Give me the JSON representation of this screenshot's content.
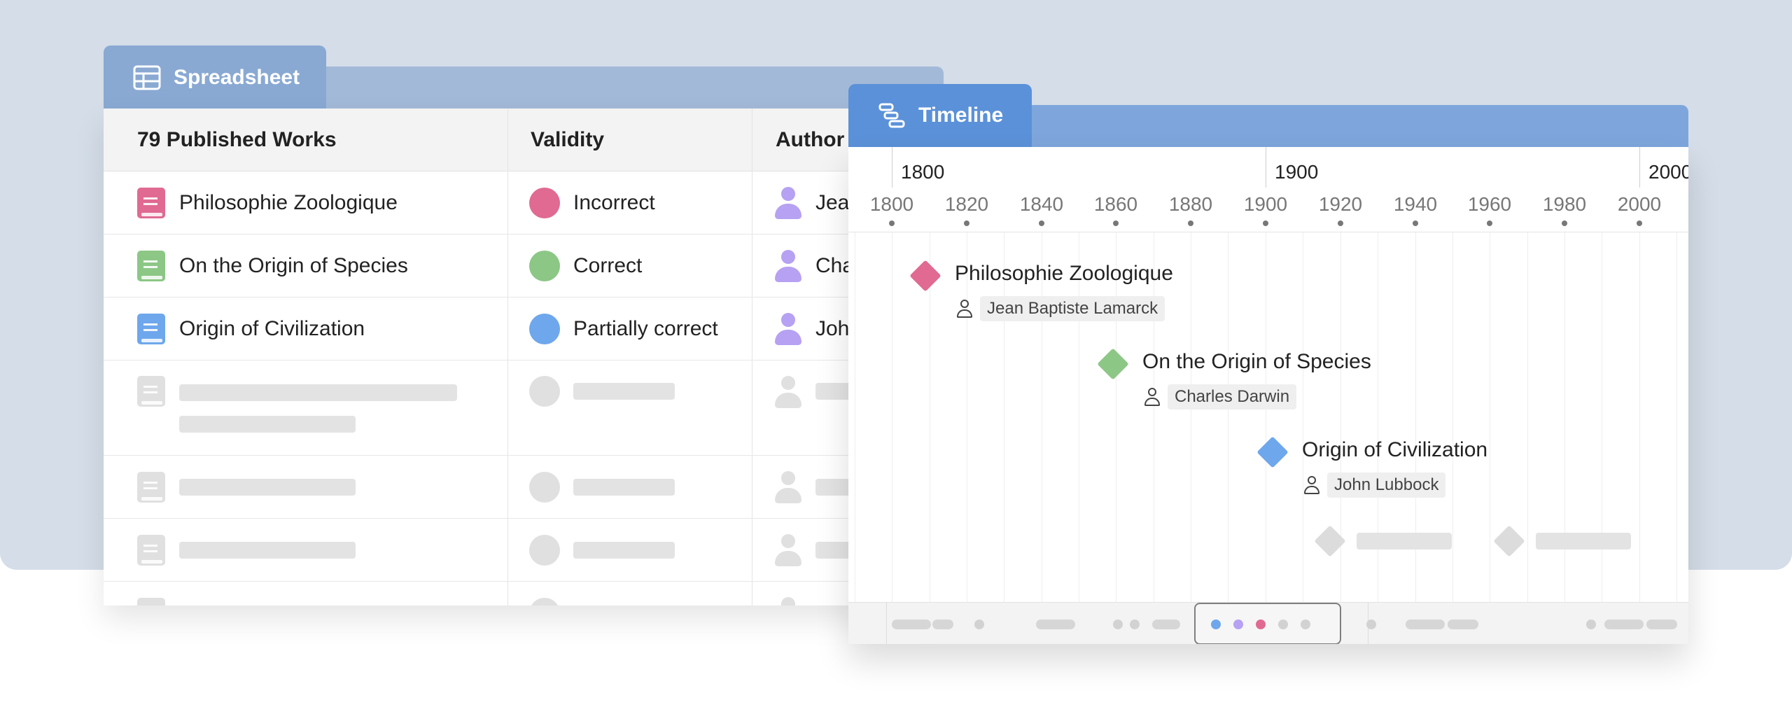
{
  "colors": {
    "background": "#d4dde8",
    "sheet_tab": "#89a9d3",
    "timeline_tab": "#5b91d8",
    "pink": "#e06a92",
    "green": "#8cc786",
    "blue": "#6ea7ec",
    "purple": "#b6a1f2",
    "placeholder": "#e3e3e3"
  },
  "spreadsheet": {
    "tab_label": "Spreadsheet",
    "tab_icon": "table-icon",
    "columns": [
      "79 Published Works",
      "Validity",
      "Author"
    ],
    "rows": [
      {
        "title": "Philosophie Zoologique",
        "validity": "Incorrect",
        "author": "Jean Baptiste Lamarck",
        "author_visible": "Jea",
        "color": "#e06a92"
      },
      {
        "title": "On the Origin of Species",
        "validity": "Correct",
        "author": "Charles Darwin",
        "author_visible": "Cha",
        "color": "#8cc786"
      },
      {
        "title": "Origin of Civilization",
        "validity": "Partially correct",
        "author": "John Lubbock",
        "author_visible": "Joh",
        "color": "#6ea7ec"
      }
    ]
  },
  "timeline": {
    "tab_label": "Timeline",
    "tab_icon": "gantt-icon",
    "century_labels": [
      "1800",
      "1900",
      "2000"
    ],
    "decade_labels": [
      "1800",
      "1820",
      "1840",
      "1860",
      "1880",
      "1900",
      "1920",
      "1940",
      "1960",
      "1980",
      "2000"
    ],
    "events": [
      {
        "title": "Philosophie Zoologique",
        "author": "Jean Baptiste Lamarck",
        "year": 1809,
        "color": "#e06a92"
      },
      {
        "title": "On the Origin of Species",
        "author": "Charles Darwin",
        "year": 1859,
        "color": "#8cc786"
      },
      {
        "title": "Origin of Civilization",
        "author": "John Lubbock",
        "year": 1902,
        "color": "#6ea7ec"
      }
    ],
    "navigator_dots": [
      "#6ea7ec",
      "#b6a1f2",
      "#e06a92",
      "#d2d2d2",
      "#d2d2d2"
    ]
  }
}
